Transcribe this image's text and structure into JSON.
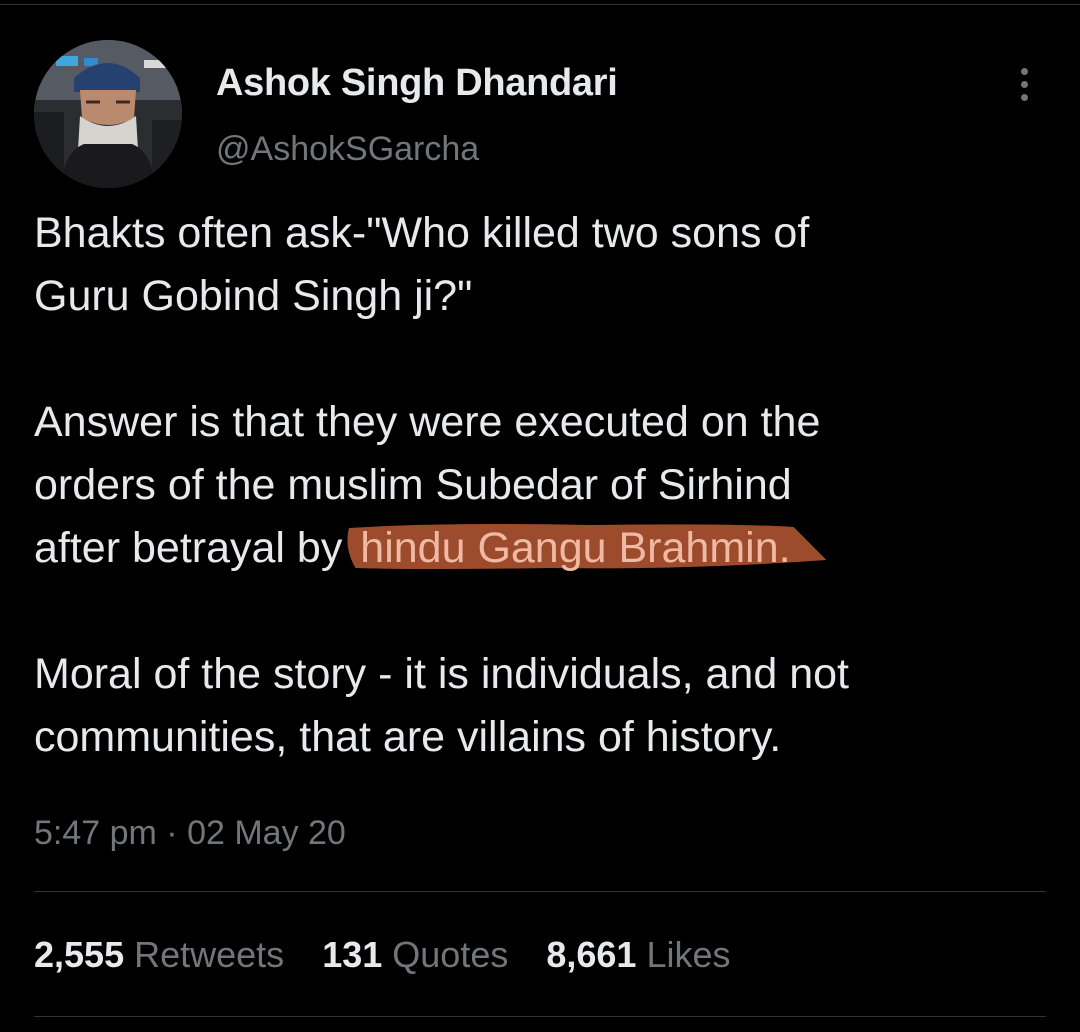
{
  "author": {
    "name": "Ashok Singh Dhandari",
    "handle": "@AshokSGarcha"
  },
  "tweet": {
    "paragraph1_line1": "Bhakts often ask-\"Who killed two sons of",
    "paragraph1_line2": "Guru Gobind Singh ji?\"",
    "paragraph2_line1": "Answer is that they were executed on the",
    "paragraph2_line2": "orders of the muslim Subedar of Sirhind",
    "paragraph2_line3_prefix": "after betrayal by ",
    "paragraph2_line3_highlight": "hindu Gangu Brahmin.",
    "paragraph3_line1": "Moral of the story - it is individuals, and not",
    "paragraph3_line2": "communities, that are villains of history."
  },
  "timestamp": "5:47 pm · 02 May 20",
  "stats": {
    "retweets_count": "2,555",
    "retweets_label": "Retweets",
    "quotes_count": "131",
    "quotes_label": "Quotes",
    "likes_count": "8,661",
    "likes_label": "Likes"
  },
  "colors": {
    "background": "#000000",
    "primary_text": "#e7e9ea",
    "secondary_text": "#71767b",
    "highlight_marker": "#9c4b2c",
    "highlight_text": "#f0b9a3"
  },
  "icons": {
    "more": "more-vertical-icon"
  }
}
